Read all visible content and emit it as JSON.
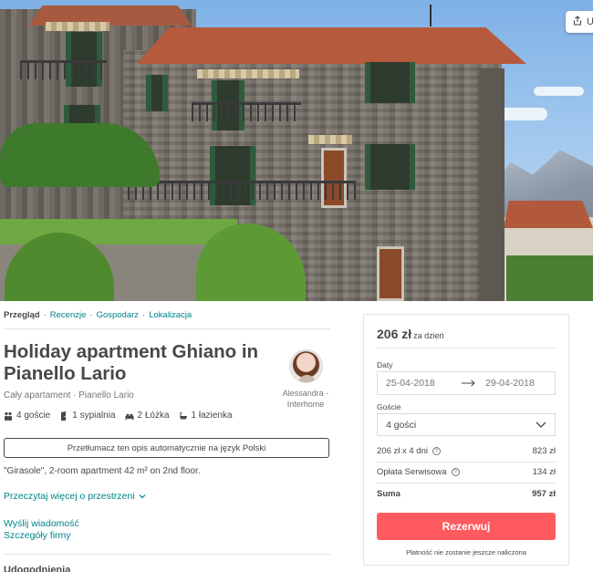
{
  "hero": {
    "share_label": "U"
  },
  "subnav": {
    "items": [
      "Przegląd",
      "Recenzje",
      "Gospodarz",
      "Lokalizacja"
    ],
    "separator": "·"
  },
  "listing": {
    "title": "Holiday apartment Ghiano in Pianello Lario",
    "subtitle": "Cały apartament · Pianello Lario",
    "host_name": "Alessandra - Interhome",
    "amenities": [
      {
        "icon": "guests-icon",
        "label": "4 goście"
      },
      {
        "icon": "bedroom-icon",
        "label": "1 sypialnia"
      },
      {
        "icon": "bed-icon",
        "label": "2 Łóżka"
      },
      {
        "icon": "bath-icon",
        "label": "1 łazienka"
      }
    ],
    "translate_label": "Przetłumacz ten opis automatycznie na język Polski",
    "description": "\"Girasole\", 2-room apartment 42 m² on 2nd floor.",
    "read_more": "Przeczytaj więcej o przestrzeni",
    "send_message": "Wyślij wiadomość",
    "company_details": "Szczegóły firmy",
    "next_section_heading": "Udogodnienia"
  },
  "booking": {
    "price": "206 zł",
    "price_unit": "za dzień",
    "dates_label": "Daty",
    "check_in": "25-04-2018",
    "check_out": "29-04-2018",
    "guests_label": "Goście",
    "guests_value": "4 gości",
    "line_nights_label": "206 zł x 4 dni",
    "line_nights_value": "823 zł",
    "line_fee_label": "Opłata Serwisowa",
    "line_fee_value": "134 zł",
    "total_label": "Suma",
    "total_value": "957 zł",
    "reserve_label": "Rezerwuj",
    "footnote": "Płatność nie zostanie jeszcze naliczona"
  },
  "colors": {
    "accent": "#008489",
    "reserve": "#ff5a5f",
    "text": "#484848"
  }
}
